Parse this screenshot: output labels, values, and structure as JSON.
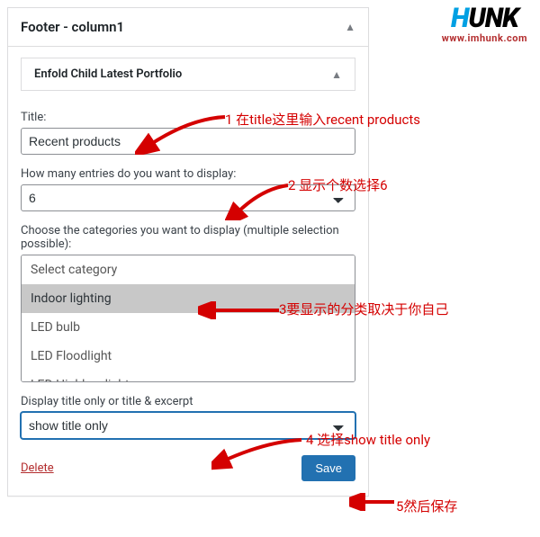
{
  "logo": {
    "h": "H",
    "rest": "UNK",
    "url": "www.imhunk.com"
  },
  "widget": {
    "header": "Footer - column1",
    "subheader": "Enfold Child Latest Portfolio"
  },
  "fields": {
    "title_label": "Title:",
    "title_value": "Recent products",
    "entries_label": "How many entries do you want to display:",
    "entries_value": "6",
    "categories_label": "Choose the categories you want to display (multiple selection possible):",
    "display_label": "Display title only or title & excerpt",
    "display_value": "show title only"
  },
  "categories": [
    {
      "label": "Select category",
      "selected": false
    },
    {
      "label": "Indoor lighting",
      "selected": true
    },
    {
      "label": "LED bulb",
      "selected": false
    },
    {
      "label": "LED Floodlight",
      "selected": false
    },
    {
      "label": "LED Highbay light",
      "selected": false
    }
  ],
  "actions": {
    "delete": "Delete",
    "save": "Save"
  },
  "annotations": {
    "a1": "1  在title这里输入recent products",
    "a2": "2 显示个数选择6",
    "a3": "3要显示的分类取决于你自己",
    "a4": "4  选择show title only",
    "a5": "5然后保存"
  }
}
